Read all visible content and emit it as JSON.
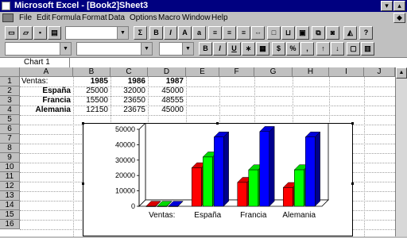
{
  "window": {
    "title": "Microsoft Excel - [Book2]Sheet3"
  },
  "menu": [
    "File",
    "Edit",
    "Formula",
    "Format",
    "Data",
    "Options",
    "Macro",
    "Window",
    "Help"
  ],
  "name_box": "Chart 1",
  "columns": [
    "A",
    "B",
    "C",
    "D",
    "E",
    "F",
    "G",
    "H",
    "I",
    "J"
  ],
  "rows": [
    "1",
    "2",
    "3",
    "4",
    "5",
    "6",
    "7",
    "8",
    "9",
    "10",
    "11",
    "12",
    "13",
    "14",
    "15",
    "16"
  ],
  "sheet": {
    "header": {
      "label": "Ventas:",
      "years": [
        "1985",
        "1986",
        "1987"
      ]
    },
    "rows": [
      {
        "country": "España",
        "values": [
          "25000",
          "32000",
          "45000"
        ]
      },
      {
        "country": "Francia",
        "values": [
          "15500",
          "23650",
          "48555"
        ]
      },
      {
        "country": "Alemania",
        "values": [
          "12150",
          "23675",
          "45000"
        ]
      }
    ]
  },
  "toolbar": {
    "sum_label": "Σ",
    "bold_label": "B",
    "italic_label": "I",
    "underline_label": "U"
  },
  "chart_data": {
    "type": "bar",
    "categories": [
      "Ventas:",
      "España",
      "Francia",
      "Alemania"
    ],
    "series": [
      {
        "values": [
          0,
          25000,
          15500,
          12150
        ],
        "color": "#ff0000"
      },
      {
        "values": [
          0,
          32000,
          23650,
          23675
        ],
        "color": "#00ff00"
      },
      {
        "values": [
          0,
          45000,
          48555,
          45000
        ],
        "color": "#0000ff"
      }
    ],
    "yticks": [
      "0",
      "10000",
      "20000",
      "30000",
      "40000",
      "50000"
    ],
    "ylim": [
      0,
      50000
    ],
    "three_d": true
  }
}
